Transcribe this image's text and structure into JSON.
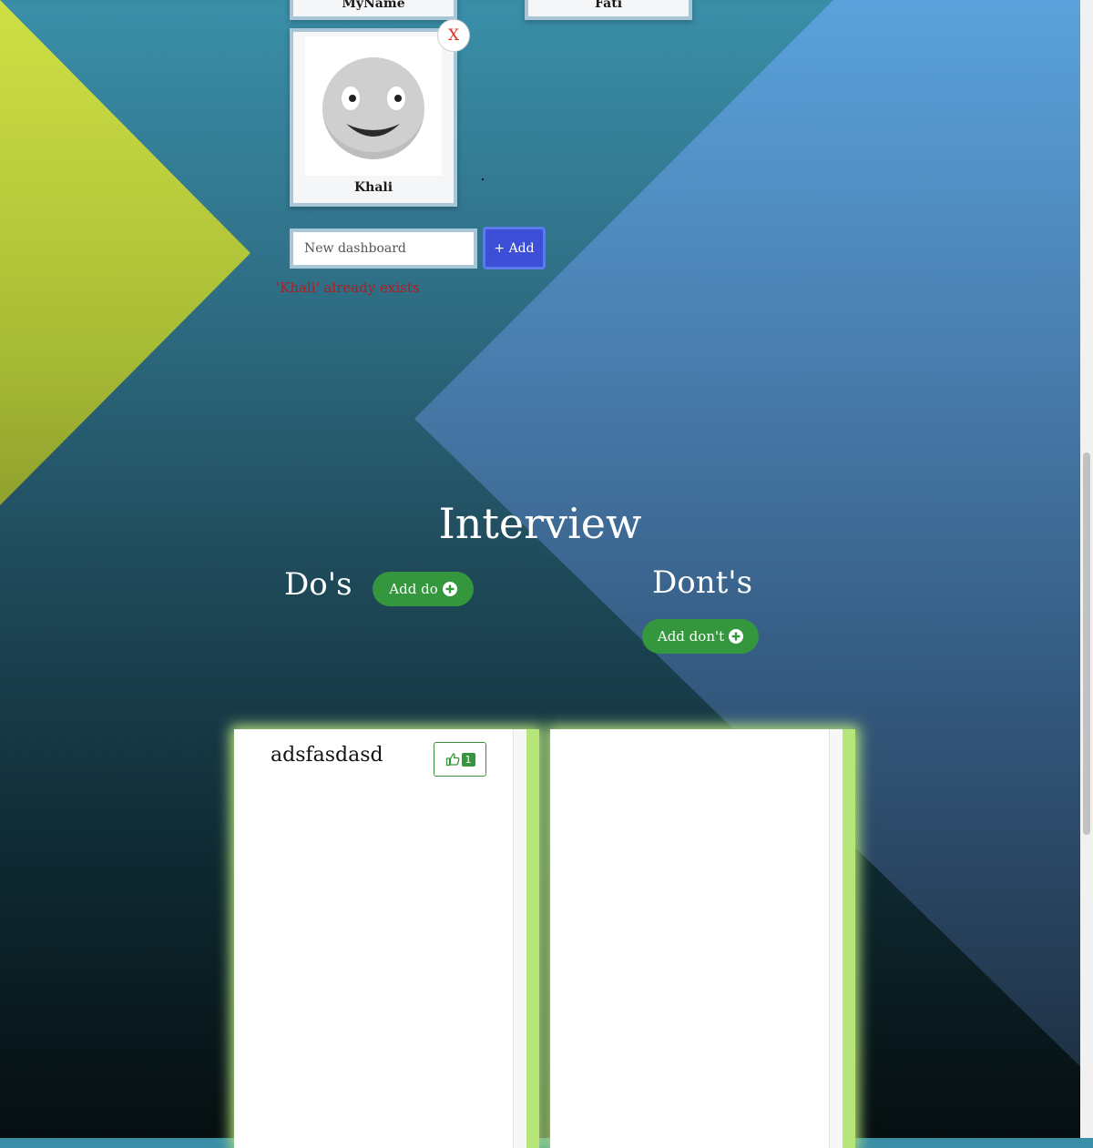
{
  "dashboards": [
    {
      "name": "MyName"
    },
    {
      "name": "Fati"
    },
    {
      "name": "Khali"
    }
  ],
  "delete_label": "X",
  "new_dashboard": {
    "placeholder": "New dashboard",
    "add_label": "+ Add"
  },
  "error_message": "'Khali' already exists",
  "section": {
    "title": "Interview",
    "dos": {
      "title": "Do's",
      "add_label": "Add do"
    },
    "donts": {
      "title": "Dont's",
      "add_label": "Add don't"
    }
  },
  "dos_items": [
    {
      "text": "adsfasdasd",
      "likes": "1"
    }
  ],
  "colors": {
    "accent": "#34973e",
    "add_button": "#3d4fd6",
    "error": "#b11d1d",
    "glow": "#b4e27c"
  }
}
